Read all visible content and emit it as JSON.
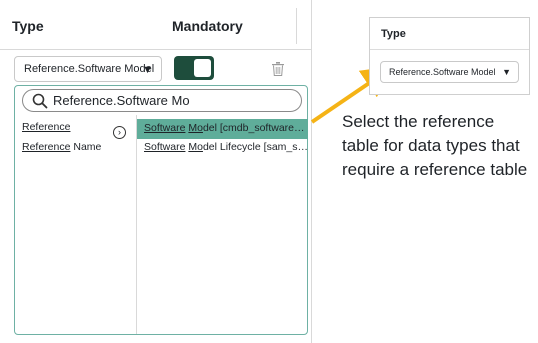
{
  "left_panel": {
    "header": {
      "type_label": "Type",
      "mandatory_label": "Mandatory"
    },
    "type_select": {
      "value": "Reference.Software Model",
      "caret": "▼"
    },
    "mandatory_toggle": {
      "state": "on",
      "color": "#1e4d3c"
    },
    "dropdown": {
      "search_value": "Reference.Software Mo",
      "left_items": [
        {
          "label": "Reference",
          "has_children": true
        },
        {
          "label_underlined": "Reference",
          "label_rest": " Name"
        }
      ],
      "right_items": [
        {
          "underlined_a": "Software",
          "gap": " ",
          "underlined_b": "Mo",
          "rest": "del [cmdb_software_p…",
          "selected": true
        },
        {
          "underlined_a": "Software",
          "gap": " ",
          "underlined_b": "Mo",
          "rest": "del Lifecycle [sam_sw…",
          "selected": false
        }
      ],
      "selected_color": "#5fad9a",
      "border_color": "#6eb1a4"
    }
  },
  "callout": {
    "header_label": "Type",
    "select_value": "Reference.Software Model",
    "caret": "▼",
    "caption_lines": [
      "Select the reference",
      "table for data types that",
      "require a reference table"
    ],
    "arrow_color": "#f5b316"
  }
}
